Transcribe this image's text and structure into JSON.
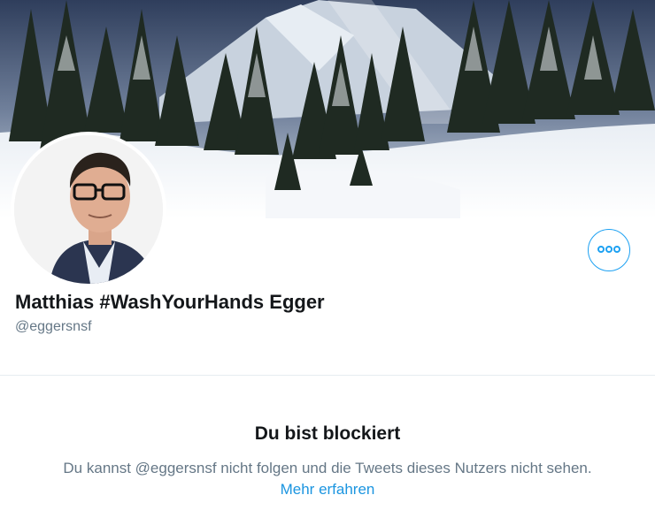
{
  "profile": {
    "display_name": "Matthias #WashYourHands Egger",
    "handle": "@eggersnsf",
    "more_icon": "more-horizontal-icon"
  },
  "blocked": {
    "title": "Du bist blockiert",
    "description": "Du kannst @eggersnsf nicht folgen und die Tweets dieses Nutzers nicht sehen.",
    "learn_more": "Mehr erfahren"
  },
  "colors": {
    "accent": "#1da1f2",
    "link": "#1b95e0",
    "text_primary": "#14171a",
    "text_secondary": "#657786"
  }
}
